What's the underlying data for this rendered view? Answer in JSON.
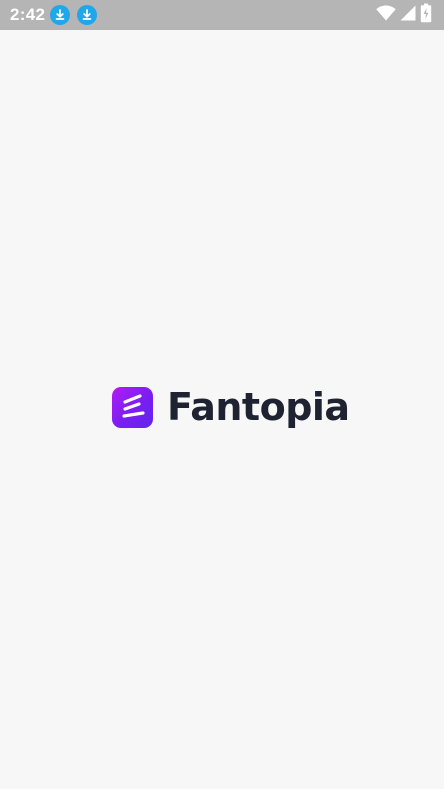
{
  "status_bar": {
    "time": "2:42",
    "left_icons": [
      "download-icon",
      "download-icon"
    ],
    "right_icons": [
      "wifi-icon",
      "cellular-signal-icon",
      "battery-charging-icon"
    ]
  },
  "splash": {
    "app_name": "Fantopia",
    "logo_icon": "fantopia-logo-icon"
  },
  "colors": {
    "background": "#f7f7f7",
    "status_bar": "#b5b5b5",
    "download_badge": "#1ea7ea",
    "logo_gradient_start": "#b11cf5",
    "logo_gradient_end": "#5e25ea",
    "brand_text": "#1f2230"
  }
}
